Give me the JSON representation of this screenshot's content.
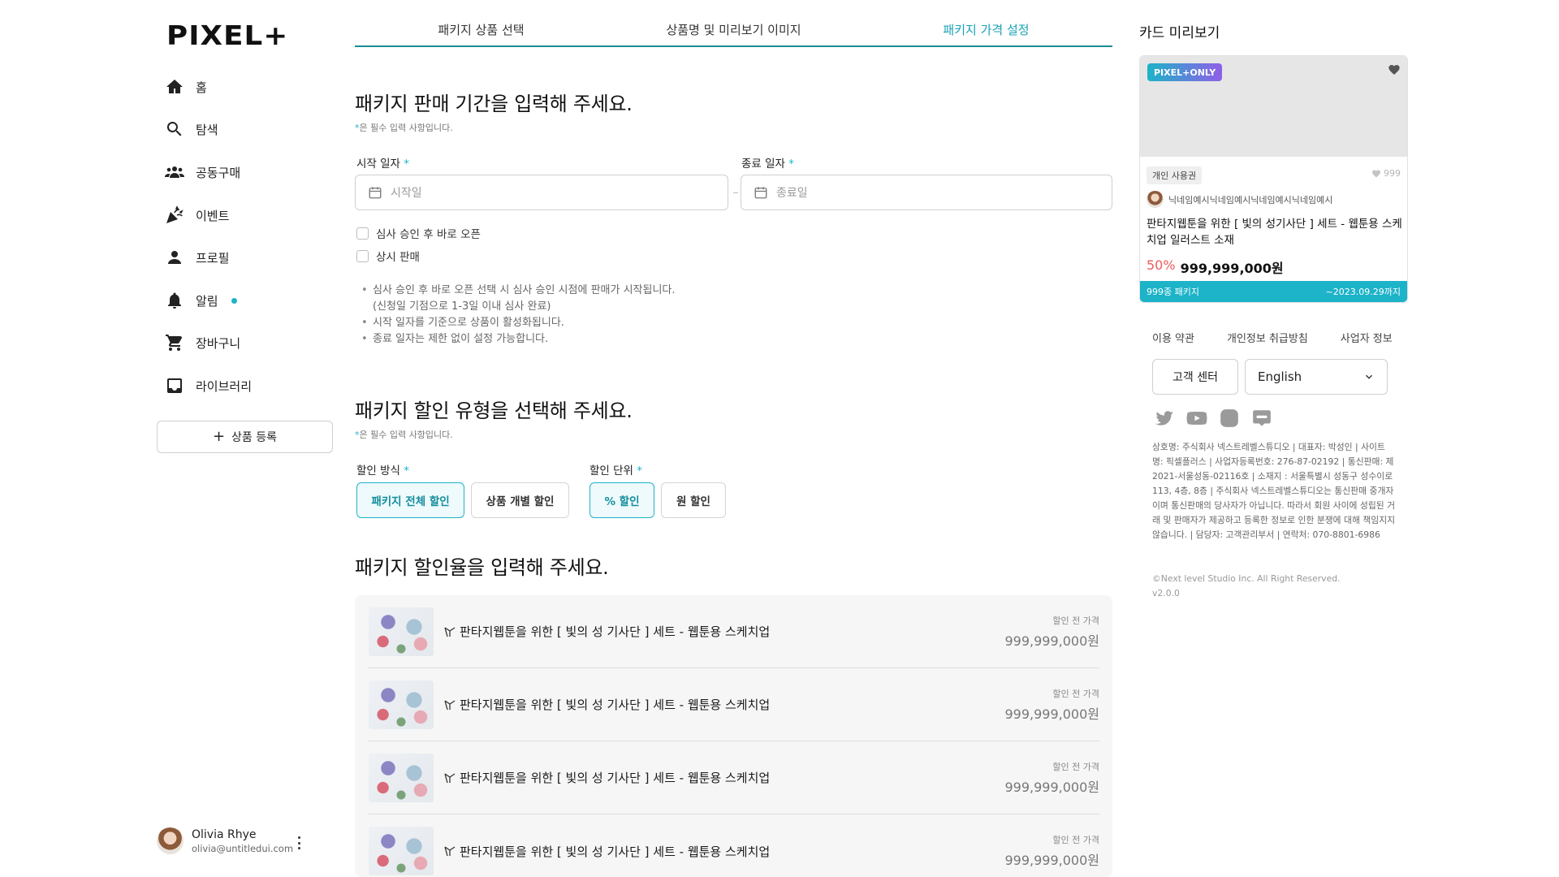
{
  "app": {
    "logo": "PIXEL+"
  },
  "sidebar": {
    "items": [
      {
        "label": "홈"
      },
      {
        "label": "탐색"
      },
      {
        "label": "공동구매"
      },
      {
        "label": "이벤트"
      },
      {
        "label": "프로필"
      },
      {
        "label": "알림"
      },
      {
        "label": "장바구니"
      },
      {
        "label": "라이브러리"
      }
    ],
    "register_label": "상품 등록",
    "user": {
      "name": "Olivia Rhye",
      "email": "olivia@untitledui.com"
    }
  },
  "tabs": [
    {
      "label": "패키지 상품 선택"
    },
    {
      "label": "상품명 및 미리보기 이미지"
    },
    {
      "label": "패키지 가격 설정"
    }
  ],
  "period": {
    "heading": "패키지 판매 기간을 입력해 주세요.",
    "required_star": "*",
    "required_note": "은 필수 입력 사항입니다.",
    "start_label": "시작 일자",
    "end_label": "종료 일자",
    "start_placeholder": "시작일",
    "end_placeholder": "종료일",
    "checkbox_open": "심사 승인 후 바로 오픈",
    "checkbox_always": "상시 판매",
    "notes": [
      "심사 승인 후 바로 오픈 선택 시 심사 승인 시점에 판매가 시작됩니다.",
      "(신청일 기점으로 1-3일 이내 심사 완료)",
      "시작 일자를 기준으로 상품이 활성화됩니다.",
      "종료 일자는 제한 없이 설정 가능합니다."
    ]
  },
  "discount": {
    "heading": "패키지 할인 유형을 선택해 주세요.",
    "required_note": "은 필수 입력 사항입니다.",
    "method_label": "할인 방식",
    "unit_label": "할인 단위",
    "method_options": [
      "패키지 전체 할인",
      "상품 개별 할인"
    ],
    "unit_options": [
      "% 할인",
      "원 할인"
    ]
  },
  "rate": {
    "heading": "패키지 할인율을 입력해 주세요.",
    "products": [
      {
        "title": "판타지웹툰을 위한 [ 빛의 성 기사단 ] 세트 - 웹툰용 스케치업",
        "price_caption": "할인 전 가격",
        "price": "999,999,000원"
      },
      {
        "title": "판타지웹툰을 위한 [ 빛의 성 기사단 ] 세트 - 웹툰용 스케치업",
        "price_caption": "할인 전 가격",
        "price": "999,999,000원"
      },
      {
        "title": "판타지웹툰을 위한 [ 빛의 성 기사단 ] 세트 - 웹툰용 스케치업",
        "price_caption": "할인 전 가격",
        "price": "999,999,000원"
      },
      {
        "title": "판타지웹툰을 위한 [ 빛의 성 기사단 ] 세트 - 웹툰용 스케치업",
        "price_caption": "할인 전 가격",
        "price": "999,999,000원"
      }
    ]
  },
  "preview": {
    "title": "카드 미리보기",
    "badge": "PIXEL+ONLY",
    "license": "개인 사용권",
    "likes": "999",
    "creator": "닉네임예시닉네임예시닉네임예시닉네임예시",
    "card_title": "판타지웹툰을 위한 [ 빛의 성기사단 ] 세트 - 웹툰용 스케치업 일러스트 소재",
    "discount_pct": "50%",
    "price": "999,999,000원",
    "package_count": "999종 패키지",
    "period": "~2023.09.29까지"
  },
  "footer": {
    "links": [
      "이용 약관",
      "개인정보 취급방침",
      "사업자 정보"
    ],
    "cs_label": "고객 센터",
    "language": "English",
    "company_info": "상호명: 주식회사 넥스트레벨스튜디오 | 대표자: 박성인 | 사이트명: 픽셀플러스 | 사업자등록번호: 276-87-02192 | 통신판매: 제 2021-서울성동-02116호 | 소재지 : 서울특별시 성동구 성수이로 113, 4층, 8층 | 주식회사 넥스트레벨스튜디오는 통신판매 중개자이며 통신판매의 당사자가 아닙니다. 따라서 회원 사이에 성립된 거래 및 판매자가 제공하고 등록한 정보로 인한 분쟁에 대해 책임지지 않습니다. | 담당자: 고객관리부서 | 연락처: 070-8801-6986",
    "copyright": "©Next level Studio Inc. All Right Reserved.",
    "version": "v2.0.0"
  },
  "colors": {
    "accent": "#1db3c8",
    "tab_line": "#1c8c94",
    "discount_red": "#ee5b5b"
  },
  "icons": [
    "home-icon",
    "search-icon",
    "group-icon",
    "party-icon",
    "person-icon",
    "bell-icon",
    "cart-icon",
    "library-icon",
    "plus-icon",
    "calendar-icon",
    "heart-icon",
    "twitter-icon",
    "youtube-icon",
    "instagram-icon",
    "blog-icon",
    "chevron-down-icon",
    "more-vertical-icon"
  ]
}
